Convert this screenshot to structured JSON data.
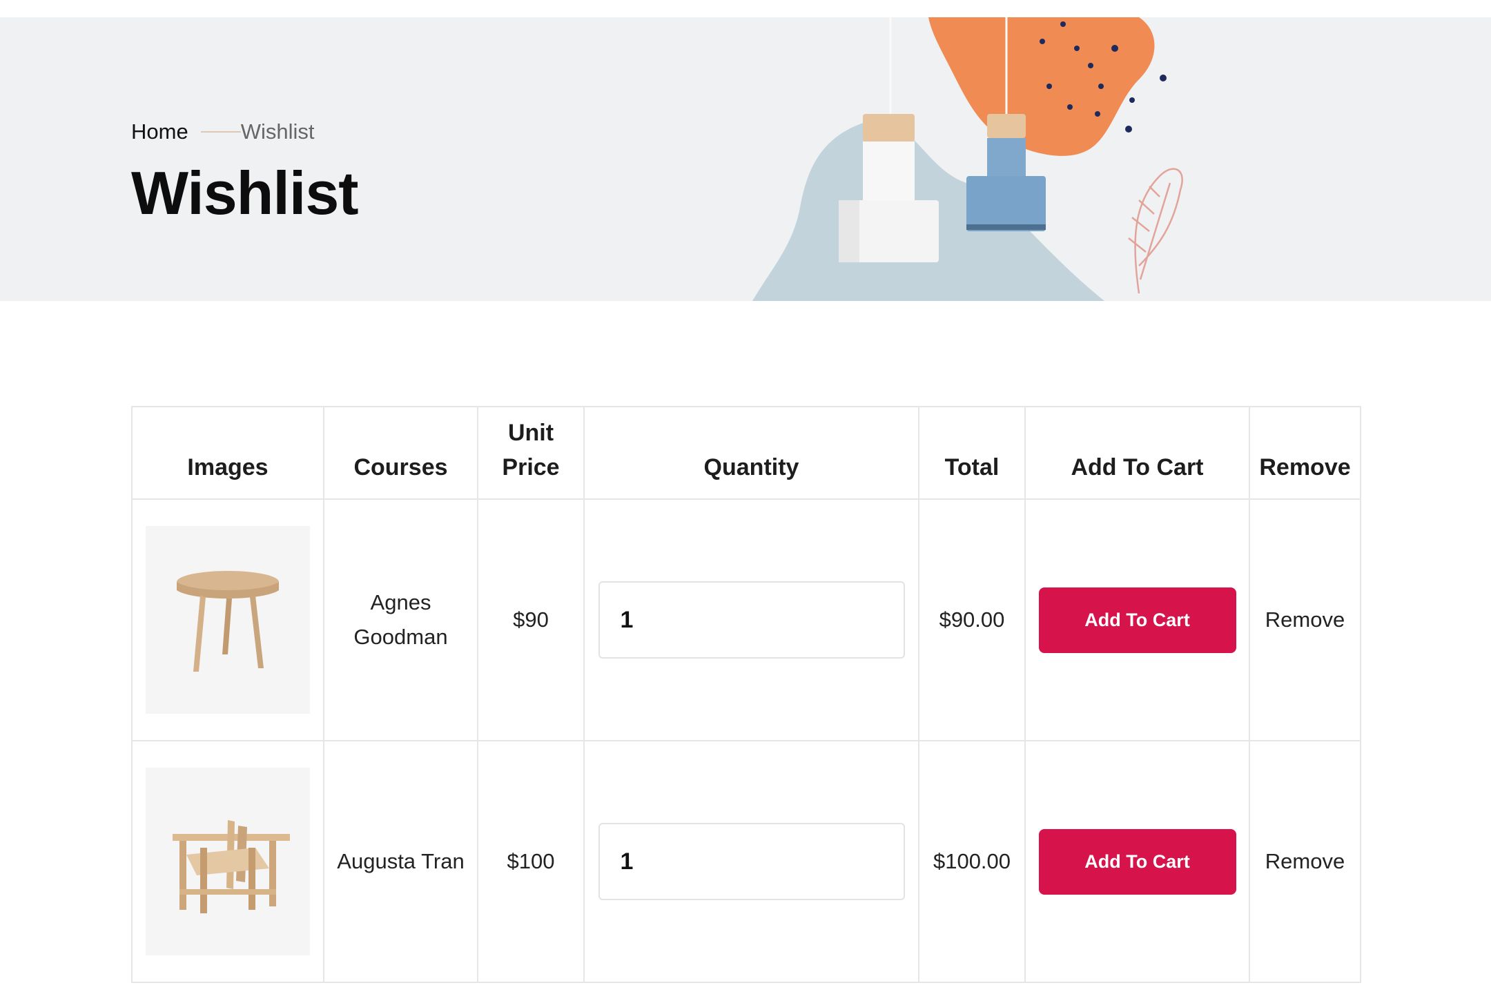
{
  "breadcrumb": {
    "home": "Home",
    "current": "Wishlist"
  },
  "page": {
    "title": "Wishlist"
  },
  "table": {
    "headers": {
      "images": "Images",
      "courses": "Courses",
      "unit_price_line1": "Unit",
      "unit_price_line2": "Price",
      "quantity": "Quantity",
      "total": "Total",
      "add_to_cart": "Add To Cart",
      "remove": "Remove"
    },
    "rows": [
      {
        "name_line1": "Agnes",
        "name_line2": "Goodman",
        "unit_price": "$90",
        "quantity": "1",
        "total": "$90.00",
        "add_to_cart_label": "Add To Cart",
        "remove_label": "Remove",
        "image_icon": "side-table-icon"
      },
      {
        "name": "Augusta Tran",
        "unit_price": "$100",
        "quantity": "1",
        "total": "$100.00",
        "add_to_cart_label": "Add To Cart",
        "remove_label": "Remove",
        "image_icon": "armchair-icon"
      }
    ]
  },
  "colors": {
    "banner_bg": "#f0f1f3",
    "accent": "#d6134a",
    "border": "#e6e6e6"
  }
}
